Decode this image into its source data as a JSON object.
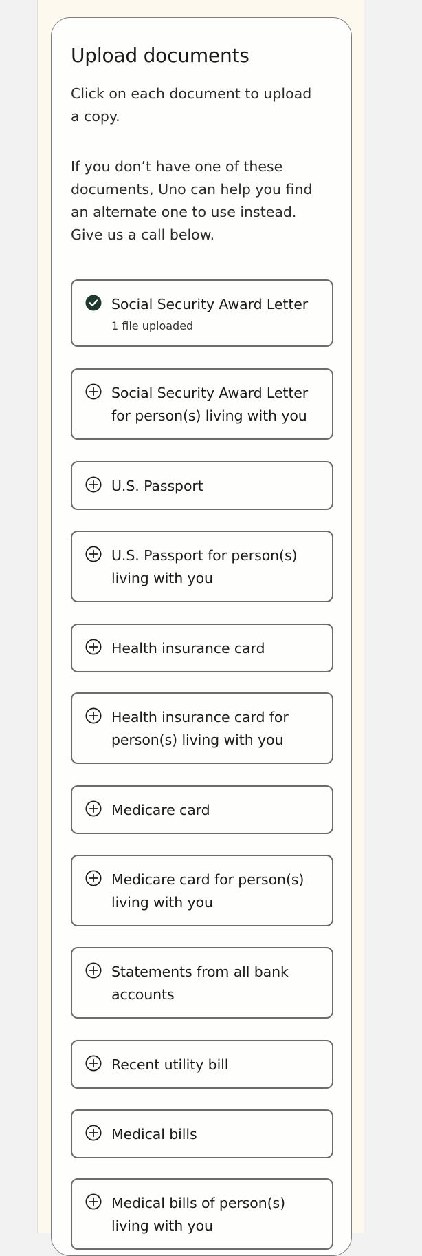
{
  "upload": {
    "title": "Upload documents",
    "intro": "Click on each document to upload a copy.",
    "help": "If you don’t have one of these documents, Uno can help you find an alternate one to use instead. Give us a call below."
  },
  "documents": [
    {
      "label": "Social Security Award Letter",
      "status": "1 file uploaded",
      "icon": "check-circle-icon"
    },
    {
      "label": "Social Security Award Letter for person(s) living with you",
      "icon": "plus-circle-icon"
    },
    {
      "label": "U.S. Passport",
      "icon": "plus-circle-icon"
    },
    {
      "label": "U.S. Passport for person(s) living with you",
      "icon": "plus-circle-icon"
    },
    {
      "label": "Health insurance card",
      "icon": "plus-circle-icon"
    },
    {
      "label": "Health insurance card for person(s) living with you",
      "icon": "plus-circle-icon"
    },
    {
      "label": "Medicare card",
      "icon": "plus-circle-icon"
    },
    {
      "label": "Medicare card for person(s) living with you",
      "icon": "plus-circle-icon"
    },
    {
      "label": "Statements from all bank accounts",
      "icon": "plus-circle-icon"
    },
    {
      "label": "Recent utility bill",
      "icon": "plus-circle-icon"
    },
    {
      "label": "Medical bills",
      "icon": "plus-circle-icon"
    },
    {
      "label": "Medical bills of person(s) living with you",
      "icon": "plus-circle-icon"
    }
  ],
  "colors": {
    "page_background": "#fdf9ef",
    "card_background": "#fefefc",
    "check_icon_fill": "#1f3a2d"
  }
}
